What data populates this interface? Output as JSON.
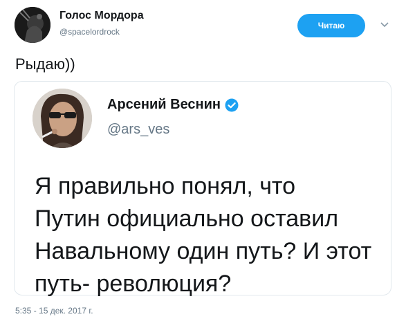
{
  "tweet": {
    "author_name": "Голос Мордора",
    "author_handle": "@spacelordrock",
    "follow_label": "Читаю",
    "text": "Рыдаю))",
    "timestamp": "5:35 - 15 дек. 2017 г."
  },
  "quoted_tweet": {
    "author_name": "Арсений Веснин",
    "author_handle": "@ars_ves",
    "verified": true,
    "text_lines": [
      "Я правильно понял, что",
      "Путин официально оставил",
      "Навальному один путь? И этот",
      "путь- революция?"
    ]
  },
  "colors": {
    "accent": "#1da1f2",
    "text": "#14171a",
    "secondary_text": "#657786",
    "border": "#e1e8ed"
  }
}
